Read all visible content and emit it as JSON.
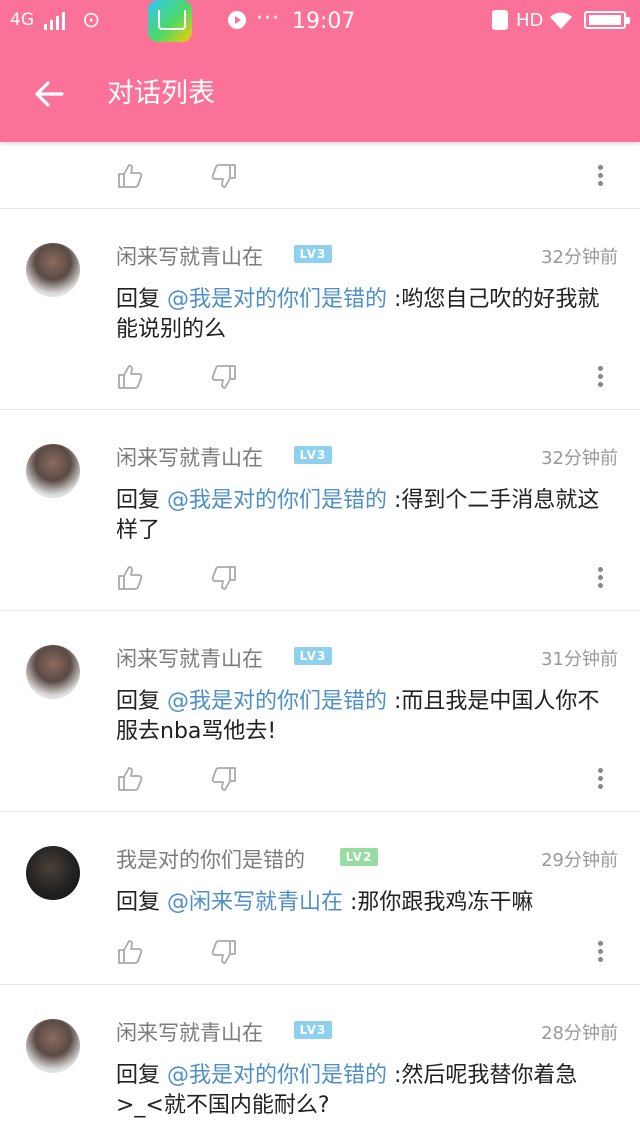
{
  "status_bar": {
    "network": "4G",
    "time": "19:07",
    "hd": "HD",
    "dots": "···"
  },
  "header": {
    "title": "对话列表",
    "color": "#fb7299"
  },
  "comments": [
    {
      "username": "闲来写就青山在",
      "level": "LV3",
      "time": "32分钟前",
      "reply_prefix": "回复 ",
      "mention": "@我是对的你们是错的",
      "text": " :哟您自己吹的好我就能说别的么"
    },
    {
      "username": "闲来写就青山在",
      "level": "LV3",
      "time": "32分钟前",
      "reply_prefix": "回复 ",
      "mention": "@我是对的你们是错的",
      "text": " :得到个二手消息就这样了"
    },
    {
      "username": "闲来写就青山在",
      "level": "LV3",
      "time": "31分钟前",
      "reply_prefix": "回复 ",
      "mention": "@我是对的你们是错的",
      "text": " :而且我是中国人你不服去nba骂他去!"
    },
    {
      "username": "我是对的你们是错的",
      "level": "LV2",
      "time": "29分钟前",
      "reply_prefix": "回复 ",
      "mention": "@闲来写就青山在",
      "text": " :那你跟我鸡冻干嘛"
    },
    {
      "username": "闲来写就青山在",
      "level": "LV3",
      "time": "28分钟前",
      "reply_prefix": "回复 ",
      "mention": "@我是对的你们是错的",
      "text": " :然后呢我替你着急>_<就不国内能耐么?"
    }
  ],
  "colors": {
    "lv3": "#8dd1ef",
    "lv2": "#97dca2",
    "mention": "#4d8fcb"
  }
}
